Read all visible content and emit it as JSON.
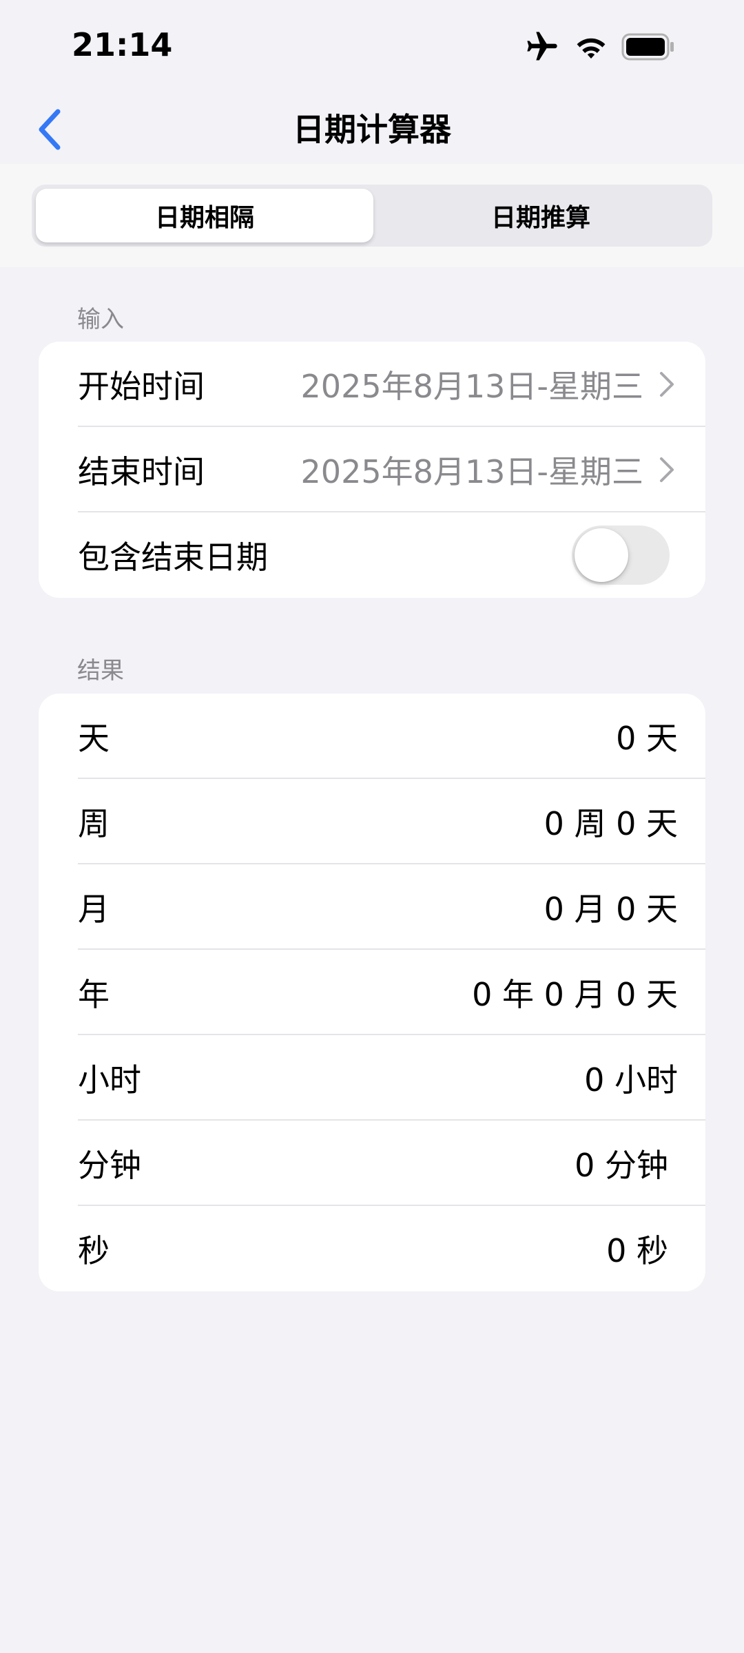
{
  "status_bar": {
    "time": "21:14",
    "icons": [
      "airplane-icon",
      "wifi-icon",
      "battery-icon"
    ]
  },
  "nav": {
    "back_icon": "chevron-left-icon",
    "title": "日期计算器"
  },
  "segments": [
    {
      "label": "日期相隔",
      "selected": true
    },
    {
      "label": "日期推算",
      "selected": false
    }
  ],
  "input_section": {
    "header": "输入",
    "start": {
      "label": "开始时间",
      "value": "2025年8月13日-星期三"
    },
    "end": {
      "label": "结束时间",
      "value": "2025年8月13日-星期三"
    },
    "include_end": {
      "label": "包含结束日期",
      "on": false
    }
  },
  "result_section": {
    "header": "结果",
    "rows": [
      {
        "label": "天",
        "value": "0 天"
      },
      {
        "label": "周",
        "value": "0 周 0 天"
      },
      {
        "label": "月",
        "value": "0 月 0 天"
      },
      {
        "label": "年",
        "value": "0 年 0 月 0 天"
      },
      {
        "label": "小时",
        "value": "0 小时"
      },
      {
        "label": "分钟",
        "value": "0 分钟"
      },
      {
        "label": "秒",
        "value": "0 秒"
      }
    ]
  },
  "colors": {
    "accent": "#3478f6",
    "background": "#f2f2f7",
    "secondary_text": "#8a8a8e"
  }
}
